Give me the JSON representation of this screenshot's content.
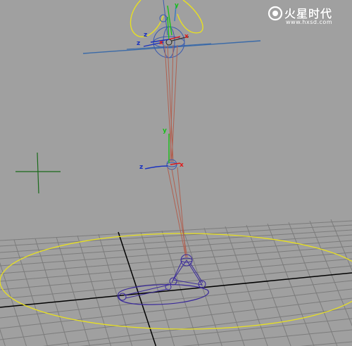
{
  "viewport": {
    "background": "#a0a0a0",
    "grid_color": "#7a7a7a",
    "grid_axis_color": "#000000"
  },
  "watermark": {
    "title": "火星时代",
    "url": "www.hxsd.com",
    "icon": "hxsd-logo-icon"
  },
  "axis_labels": {
    "hip_z": "z",
    "hip_z2": "z",
    "hip_x": "x",
    "hip_y": "y",
    "knee_y": "y",
    "knee_z": "z",
    "knee_x": "x"
  },
  "colors": {
    "bone": "#b06050",
    "control_curve": "#e8e020",
    "foot_control": "#3a2a9a",
    "hip_plane": "#3a6aa8",
    "axis_x": "#e01818",
    "axis_y": "#18c018",
    "axis_z": "#1830c0",
    "locator": "#1a6a1a"
  }
}
